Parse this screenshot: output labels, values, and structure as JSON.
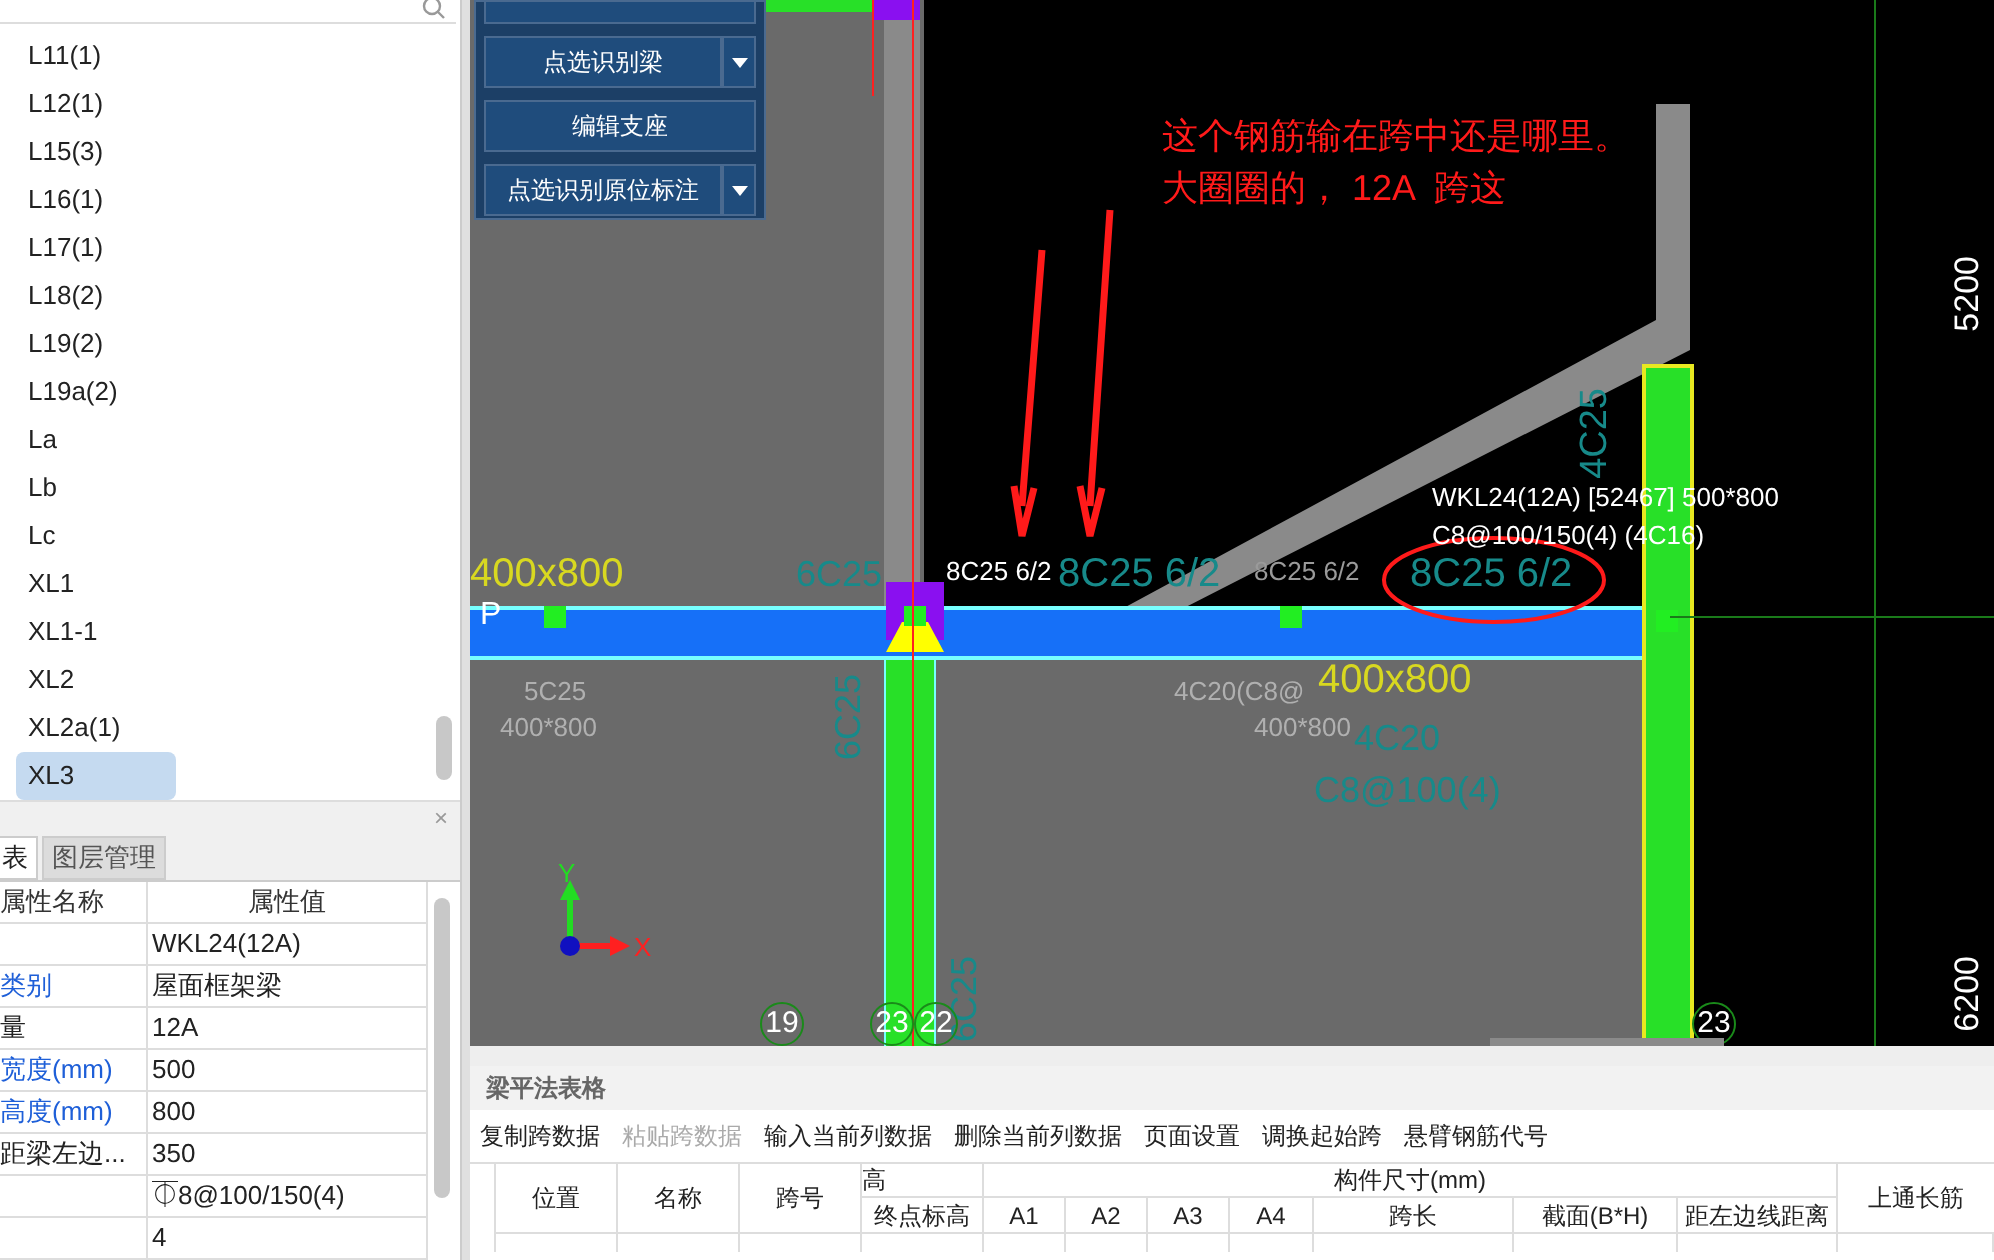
{
  "component_list": {
    "items": [
      {
        "label": "L11(1)",
        "selected": false
      },
      {
        "label": "L12(1)",
        "selected": false
      },
      {
        "label": "L15(3)",
        "selected": false
      },
      {
        "label": "L16(1)",
        "selected": false
      },
      {
        "label": "L17(1)",
        "selected": false
      },
      {
        "label": "L18(2)",
        "selected": false
      },
      {
        "label": "L19(2)",
        "selected": false
      },
      {
        "label": "L19a(2)",
        "selected": false
      },
      {
        "label": "La",
        "selected": false
      },
      {
        "label": "Lb",
        "selected": false
      },
      {
        "label": "Lc",
        "selected": false
      },
      {
        "label": "XL1",
        "selected": false
      },
      {
        "label": "XL1-1",
        "selected": false
      },
      {
        "label": "XL2",
        "selected": false
      },
      {
        "label": "XL2a(1)",
        "selected": false
      },
      {
        "label": "XL3",
        "selected": true
      }
    ]
  },
  "properties": {
    "close": "×",
    "tabs": [
      {
        "label": "表",
        "selected": true
      },
      {
        "label": "图层管理",
        "selected": false
      }
    ],
    "columns": [
      "属性名称",
      "属性值"
    ],
    "rows": [
      {
        "value": "WKL24(12A)"
      },
      {
        "name": "类别",
        "public": true,
        "value": "屋面框架梁"
      },
      {
        "name": "量",
        "public": false,
        "value": "12A"
      },
      {
        "name": "宽度(mm)",
        "public": true,
        "value": "500"
      },
      {
        "name": "高度(mm)",
        "public": true,
        "value": "800"
      },
      {
        "name": "距梁左边...",
        "public": false,
        "value": "350"
      },
      {
        "value": "⏁8@100/150(4)"
      },
      {
        "value": "4"
      }
    ]
  },
  "tool_buttons": [
    {
      "label": "点选识别梁",
      "dropdown": true
    },
    {
      "label": "编辑支座",
      "dropdown": false
    },
    {
      "label": "点选识别原位标注",
      "dropdown": true
    }
  ],
  "canvas": {
    "annotation": [
      "这个钢筋输在跨中还是哪里。",
      "大圈圈的， 12A  跨这"
    ],
    "labels": [
      {
        "text": "5200",
        "color": "#ffffff"
      },
      {
        "text": "4C25",
        "color": "#178a8a"
      },
      {
        "text": "WKL24(12A) [52467] 500*800",
        "color": "#ffffff"
      },
      {
        "text": "C8@100/150(4) (4C16)",
        "color": "#ffffff"
      },
      {
        "text": "400x800",
        "color": "#d8d820"
      },
      {
        "text": "6C25",
        "color": "#178a8a"
      },
      {
        "text": "8C25 6/2",
        "color": "#ffffff"
      },
      {
        "text": "8C25  6/2",
        "color": "#178a8a"
      },
      {
        "text": "8C25 6/2",
        "color": "#9a9a9a"
      },
      {
        "text": "8C25  6/2",
        "color": "#178a8a"
      },
      {
        "text": "P",
        "color": "#ffffff"
      },
      {
        "text": "400x800",
        "color": "#d8d820"
      },
      {
        "text": "5C25",
        "color": "#b0b0b0"
      },
      {
        "text": "4C20(C8@",
        "color": "#b0b0b0"
      },
      {
        "text": "6C25",
        "color": "#178a8a"
      },
      {
        "text": "400*800",
        "color": "#b0b0b0"
      },
      {
        "text": "400*800",
        "color": "#b0b0b0"
      },
      {
        "text": "4C20",
        "color": "#178a8a"
      },
      {
        "text": "C8@100(4)",
        "color": "#178a8a"
      },
      {
        "text": "6C25",
        "color": "#178a8a"
      },
      {
        "text": "6200",
        "color": "#ffffff"
      }
    ],
    "axis_marks": [
      "19",
      "23",
      "22",
      "23"
    ],
    "axis_x": "X",
    "axis_y": "Y"
  },
  "beam_table": {
    "title": "梁平法表格",
    "toolbar": [
      {
        "label": "复制跨数据",
        "disabled": false
      },
      {
        "label": "粘贴跨数据",
        "disabled": true
      },
      {
        "label": "输入当前列数据",
        "disabled": false
      },
      {
        "label": "删除当前列数据",
        "disabled": false
      },
      {
        "label": "页面设置",
        "disabled": false
      },
      {
        "label": "调换起始跨",
        "disabled": false
      },
      {
        "label": "悬臂钢筋代号",
        "disabled": false
      }
    ],
    "headers": {
      "position": "位置",
      "name": "名称",
      "span": "跨号",
      "elevation": "高",
      "end_elevation": "终点标高",
      "size_group": "构件尺寸(mm)",
      "size_columns": [
        "A1",
        "A2",
        "A3",
        "A4",
        "跨长",
        "截面(B*H)",
        "距左边线距离"
      ],
      "top_bar": "上通长筋"
    }
  }
}
